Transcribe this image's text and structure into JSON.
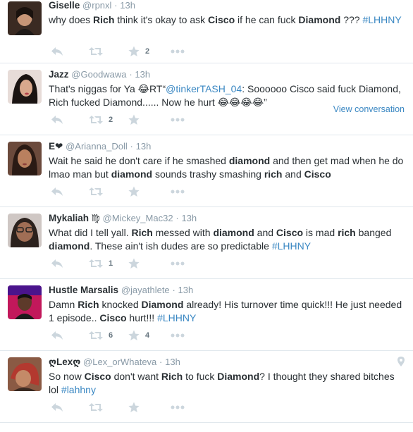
{
  "tweets": [
    {
      "name": "Giselle",
      "handle": "@rpnxl",
      "time": "13h",
      "segments": [
        {
          "t": "why does "
        },
        {
          "t": "Rich",
          "b": true
        },
        {
          "t": " think it's okay to ask "
        },
        {
          "t": "Cisco",
          "b": true
        },
        {
          "t": " if he can fuck "
        },
        {
          "t": "Diamond",
          "b": true
        },
        {
          "t": " ??? "
        },
        {
          "t": "#LHHNY",
          "tag": true
        }
      ],
      "retweets": "",
      "favorites": "2"
    },
    {
      "name": "Jazz",
      "handle": "@Goodwawa",
      "time": "13h",
      "segments": [
        {
          "t": "That's niggas for Ya 😂RT“"
        },
        {
          "t": "@tinkerTASH_04",
          "tag": true
        },
        {
          "t": ": Soooooo Cisco said fuck Diamond, Rich fucked Diamond...... Now he hurt 😂😂😂😂”"
        }
      ],
      "retweets": "2",
      "favorites": "",
      "view_conversation": "View conversation"
    },
    {
      "name": "E❤",
      "handle": "@Arianna_Doll",
      "time": "13h",
      "segments": [
        {
          "t": "Wait he said he don't care if he smashed "
        },
        {
          "t": "diamond",
          "b": true
        },
        {
          "t": " and then get mad when he do lmao man but "
        },
        {
          "t": "diamond",
          "b": true
        },
        {
          "t": " sounds trashy smashing "
        },
        {
          "t": "rich",
          "b": true
        },
        {
          "t": " and "
        },
        {
          "t": "Cisco",
          "b": true
        }
      ],
      "retweets": "",
      "favorites": ""
    },
    {
      "name": "Mykaliah ♍",
      "handle": "@Mickey_Mac32",
      "time": "13h",
      "segments": [
        {
          "t": "What did I tell yall. "
        },
        {
          "t": "Rich",
          "b": true
        },
        {
          "t": " messed with "
        },
        {
          "t": "diamond",
          "b": true
        },
        {
          "t": " and "
        },
        {
          "t": "Cisco",
          "b": true
        },
        {
          "t": " is mad "
        },
        {
          "t": "rich",
          "b": true
        },
        {
          "t": " banged "
        },
        {
          "t": "diamond",
          "b": true
        },
        {
          "t": ". These ain't ish dudes are so predictable "
        },
        {
          "t": "#LHHNY",
          "tag": true
        }
      ],
      "retweets": "1",
      "favorites": ""
    },
    {
      "name": "Hustle Marsalis",
      "handle": "@jayathlete",
      "time": "13h",
      "segments": [
        {
          "t": "Damn "
        },
        {
          "t": "Rich",
          "b": true
        },
        {
          "t": " knocked "
        },
        {
          "t": "Diamond",
          "b": true
        },
        {
          "t": " already! His turnover time quick!!! He just needed 1 episode.. "
        },
        {
          "t": "Cisco",
          "b": true
        },
        {
          "t": " hurt!!! "
        },
        {
          "t": "#LHHNY",
          "tag": true
        }
      ],
      "retweets": "6",
      "favorites": "4"
    },
    {
      "name": "ღLexღ",
      "handle": "@Lex_orWhateva",
      "time": "13h",
      "segments": [
        {
          "t": "So now "
        },
        {
          "t": "Cisco",
          "b": true
        },
        {
          "t": " don't want "
        },
        {
          "t": "Rich",
          "b": true
        },
        {
          "t": " to fuck "
        },
        {
          "t": "Diamond",
          "b": true
        },
        {
          "t": "? I thought they shared bitches lol "
        },
        {
          "t": "#lahhny",
          "tag": true
        }
      ],
      "retweets": "",
      "favorites": "",
      "geo_icon": "location-pin-icon"
    }
  ],
  "icons": {
    "reply": "reply-icon",
    "retweet": "retweet-icon",
    "favorite": "star-icon",
    "more": "more-icon"
  },
  "colors": {
    "link": "#3b88c3",
    "meta": "#8899a6",
    "icon": "#ccd6dd"
  }
}
